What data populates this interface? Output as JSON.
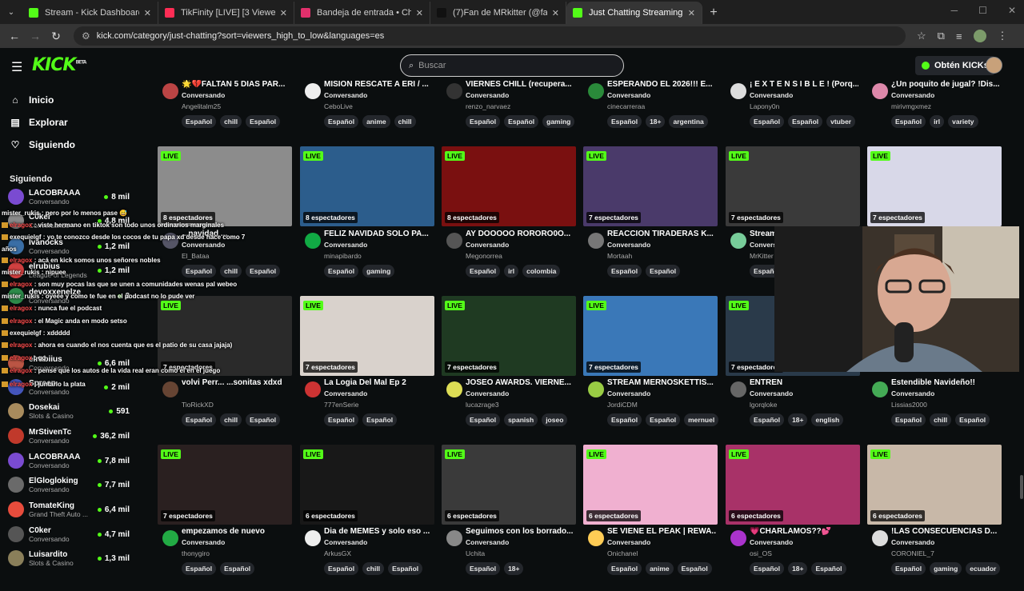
{
  "browser": {
    "tabs": [
      {
        "title": "Stream - Kick Dashboard",
        "color": "#53fc18",
        "active": false
      },
      {
        "title": "TikFinity [LIVE] [3 Viewers]",
        "color": "#ff2d55",
        "active": false
      },
      {
        "title": "Bandeja de entrada • Chats",
        "color": "#e1306c",
        "active": false
      },
      {
        "title": "(7)Fan de MRkitter (@fandepe...",
        "color": "#111111",
        "active": false
      },
      {
        "title": "Just Chatting Streaming - Live S...",
        "color": "#53fc18",
        "active": true
      }
    ],
    "url": "kick.com/category/just-chatting?sort=viewers_high_to_low&languages=es"
  },
  "header": {
    "logo": "KICK",
    "logo_beta": "BETA",
    "search_placeholder": "Buscar",
    "get_kicks_label": "Obtén KICKs"
  },
  "sidebar": {
    "nav": [
      {
        "label": "Inicio",
        "icon": "home-icon"
      },
      {
        "label": "Explorar",
        "icon": "browse-icon"
      },
      {
        "label": "Siguiendo",
        "icon": "heart-icon"
      }
    ],
    "following_title": "Siguiendo",
    "following": [
      {
        "name": "LACOBRAAA",
        "game": "Conversando",
        "viewers": "8 mil",
        "color": "#7a4bd1"
      },
      {
        "name": "C0ker",
        "game": "Conversando",
        "viewers": "4,8 mil",
        "color": "#8a8a8a"
      },
      {
        "name": "Ivanocks",
        "game": "Conversando",
        "viewers": "1,2 mil",
        "color": "#3a6ea5"
      },
      {
        "name": "elrubius",
        "game": "League of Legends",
        "viewers": "1,2 mil",
        "color": "#d04040"
      },
      {
        "name": "devoxxenelze",
        "game": "Conversando",
        "viewers": "2",
        "color": "#2d8a4a"
      },
      {
        "name": "Recomendados",
        "game": "",
        "viewers": "",
        "color": "#333333"
      },
      {
        "name": "elrubiius",
        "game": "Conversando",
        "viewers": "6,6 mil",
        "color": "#bb5544"
      },
      {
        "name": "Spreen",
        "game": "Conversando",
        "viewers": "2 mil",
        "color": "#4455bb"
      },
      {
        "name": "Dosekai",
        "game": "Slots & Casino",
        "viewers": "591",
        "color": "#a88b5d"
      },
      {
        "name": "MrStivenTc",
        "game": "Conversando",
        "viewers": "36,2 mil",
        "color": "#c0392b"
      },
      {
        "name": "LACOBRAAA",
        "game": "Conversando",
        "viewers": "7,8 mil",
        "color": "#7a4bd1"
      },
      {
        "name": "ElGlogloking",
        "game": "Conversando",
        "viewers": "7,7 mil",
        "color": "#6a6a6a"
      },
      {
        "name": "TomateKing",
        "game": "Grand Theft Auto ...",
        "viewers": "6,4 mil",
        "color": "#e74c3c"
      },
      {
        "name": "C0ker",
        "game": "Conversando",
        "viewers": "4,7 mil",
        "color": "#555555"
      },
      {
        "name": "Luisardito",
        "game": "Slots & Casino",
        "viewers": "1,3 mil",
        "color": "#8a7f5a"
      }
    ]
  },
  "chat": [
    {
      "user": "mister_rukis",
      "text": "pero por lo menos pase 😅",
      "badge": false
    },
    {
      "user": "elragox",
      "text": "viste hermano en tiktok son todo unos ordinarios marginales",
      "badge": true
    },
    {
      "user": "exequielgf",
      "text": "yo te conozco desde los cocos de tu papa xd desde hace como 7",
      "badge": true
    },
    {
      "user": "",
      "text": "años",
      "badge": false
    },
    {
      "user": "elragox",
      "text": "acá en kick somos unos señores nobles",
      "badge": true
    },
    {
      "user": "mister_rukis",
      "text": "nipuee",
      "badge": false
    },
    {
      "user": "elragox",
      "text": "son muy pocas las que se unen a comunidades wenas pal webeo",
      "badge": true
    },
    {
      "user": "mister_rukis",
      "text": "oyeee y como te fue en el podcast no lo pude ver",
      "badge": false
    },
    {
      "user": "elragox",
      "text": "nunca fue el podcast",
      "badge": true
    },
    {
      "user": "elragox",
      "text": "el Magic anda en modo setso",
      "badge": true
    },
    {
      "user": "exequielgf",
      "text": "xddddd",
      "badge": true
    },
    {
      "user": "elragox",
      "text": "ahora es cuando el nos cuenta que es el patio de su casa jajaja)",
      "badge": true
    },
    {
      "user": "elragox",
      "text": "gg",
      "badge": true
    },
    {
      "user": "elragox",
      "text": "pensé que los autos de la vida real eran como el en el juego",
      "badge": true
    },
    {
      "user": "elragox",
      "text": "juntarlo la plata",
      "badge": true
    }
  ],
  "streams": [
    {
      "title": "🌟💔FALTAN 5 DIAS PAR...",
      "category": "Conversando",
      "channel": "Angelitalm25",
      "viewers": "",
      "tags": [
        "Español",
        "chill",
        "Español"
      ],
      "thumb": "",
      "avatar": "#b44"
    },
    {
      "title": "MISION RESCATE A ERI / ...",
      "category": "Conversando",
      "channel": "CeboLive",
      "viewers": "",
      "tags": [
        "Español",
        "anime",
        "chill"
      ],
      "thumb": "",
      "avatar": "#eee"
    },
    {
      "title": "VIERNES CHILL (recupera...",
      "category": "Conversando",
      "channel": "renzo_narvaez",
      "viewers": "",
      "tags": [
        "Español",
        "Español",
        "gaming"
      ],
      "thumb": "",
      "avatar": "#333"
    },
    {
      "title": "ESPERANDO EL 2026!!! E...",
      "category": "Conversando",
      "channel": "cinecarreraa",
      "viewers": "",
      "tags": [
        "Español",
        "18+",
        "argentina"
      ],
      "thumb": "",
      "avatar": "#2a8a3a"
    },
    {
      "title": "¡ E X T E N S I B L E ! (Porq...",
      "category": "Conversando",
      "channel": "Lapony0n",
      "viewers": "",
      "tags": [
        "Español",
        "Español",
        "vtuber"
      ],
      "thumb": "",
      "avatar": "#ddd"
    },
    {
      "title": "¿Un poquito de jugal? !Dis...",
      "category": "Conversando",
      "channel": "mirivmgxmez",
      "viewers": "",
      "tags": [
        "Español",
        "irl",
        "variety"
      ],
      "thumb": "",
      "avatar": "#d8a"
    },
    {
      "title": "...navidad ...",
      "category": "Conversando",
      "channel": "El_Bataa",
      "viewers": "8 espectadores",
      "tags": [
        "Español",
        "chill",
        "Español"
      ],
      "thumb": "#8c8c8c",
      "avatar": "#556"
    },
    {
      "title": "FELIZ NAVIDAD SOLO PA...",
      "category": "Conversando",
      "channel": "minapibardo",
      "viewers": "8 espectadores",
      "tags": [
        "Español",
        "gaming"
      ],
      "thumb": "#2c5d8c",
      "avatar": "#1a4"
    },
    {
      "title": "AY DOOOOO RORORO0O...",
      "category": "Conversando",
      "channel": "Megonorrea",
      "viewers": "8 espectadores",
      "tags": [
        "Español",
        "irl",
        "colombia"
      ],
      "thumb": "#7a1010",
      "avatar": "#555"
    },
    {
      "title": "REACCION TIRADERAS K...",
      "category": "Conversando",
      "channel": "Mortaah",
      "viewers": "7 espectadores",
      "tags": [
        "Español",
        "Español"
      ],
      "thumb": "#4a3a6a",
      "avatar": "#777"
    },
    {
      "title": "Stream...",
      "category": "Conversando",
      "channel": "MrKitter",
      "viewers": "7 espectadores",
      "tags": [
        "Español"
      ],
      "thumb": "#3a3a3a",
      "avatar": "#7c9"
    },
    {
      "title": "",
      "category": "",
      "channel": "",
      "viewers": "7 espectadores",
      "tags": [],
      "thumb": "#d8d8e8",
      "avatar": ""
    },
    {
      "title": "volvi Perr... ...sonitas xdxd",
      "category": "",
      "channel": "TioRickXD",
      "viewers": "7 espectadores",
      "tags": [
        "Español",
        "chill",
        "Español"
      ],
      "thumb": "#2a2a2a",
      "avatar": "#643"
    },
    {
      "title": "La Logia Del Mal Ep 2",
      "category": "Conversando",
      "channel": "777enSerie",
      "viewers": "7 espectadores",
      "tags": [
        "Español",
        "Español"
      ],
      "thumb": "#d9d2cc",
      "avatar": "#c33"
    },
    {
      "title": "JOSEO AWARDS. VIERNE...",
      "category": "Conversando",
      "channel": "lucazrage3",
      "viewers": "7 espectadores",
      "tags": [
        "Español",
        "spanish",
        "joseo"
      ],
      "thumb": "#1f3a22",
      "avatar": "#dd5"
    },
    {
      "title": "STREAM MERNOSKETTIS...",
      "category": "Conversando",
      "channel": "JordiCDM",
      "viewers": "7 espectadores",
      "tags": [
        "Español",
        "Español",
        "mernuel"
      ],
      "thumb": "#3a78b8",
      "avatar": "#9c4"
    },
    {
      "title": "ENTREN",
      "category": "Conversando",
      "channel": "lgorqloke",
      "viewers": "7 espectadores",
      "tags": [
        "Español",
        "18+",
        "english"
      ],
      "thumb": "#2a3a4a",
      "avatar": "#666"
    },
    {
      "title": "Estendible Navideño!!",
      "category": "Conversando",
      "channel": "Lissias2000",
      "viewers": "",
      "tags": [
        "Español",
        "chill",
        "Español"
      ],
      "thumb": "",
      "avatar": "#4a5"
    },
    {
      "title": "empezamos de nuevo",
      "category": "Conversando",
      "channel": "thonygiro",
      "viewers": "7 espectadores",
      "tags": [
        "Español",
        "Español"
      ],
      "thumb": "#2a2020",
      "avatar": "#2a4"
    },
    {
      "title": "Dia de MEMES y solo eso ...",
      "category": "Conversando",
      "channel": "ArkusGX",
      "viewers": "6 espectadores",
      "tags": [
        "Español",
        "chill",
        "Español"
      ],
      "thumb": "#181818",
      "avatar": "#eee"
    },
    {
      "title": "Seguimos con los borrado...",
      "category": "Conversando",
      "channel": "Uchita",
      "viewers": "6 espectadores",
      "tags": [
        "Español",
        "18+"
      ],
      "thumb": "#3a3a3a",
      "avatar": "#888"
    },
    {
      "title": "SE VIENE EL PEAK | REWA...",
      "category": "Conversando",
      "channel": "Onichanel",
      "viewers": "6 espectadores",
      "tags": [
        "Español",
        "anime",
        "Español"
      ],
      "thumb": "#f0b0d0",
      "avatar": "#fc5"
    },
    {
      "title": "💗CHARLAMOS??💕",
      "category": "Conversando",
      "channel": "osi_OS",
      "viewers": "6 espectadores",
      "tags": [
        "Español",
        "18+",
        "Español"
      ],
      "thumb": "#a83268",
      "avatar": "#a3c"
    },
    {
      "title": "!LAS CONSECUENCIAS D...",
      "category": "Conversando",
      "channel": "CORONIEL_7",
      "viewers": "6 espectadores",
      "tags": [
        "Español",
        "gaming",
        "ecuador"
      ],
      "thumb": "#c8b8a8",
      "avatar": "#ddd"
    }
  ],
  "live_label": "LIVE"
}
